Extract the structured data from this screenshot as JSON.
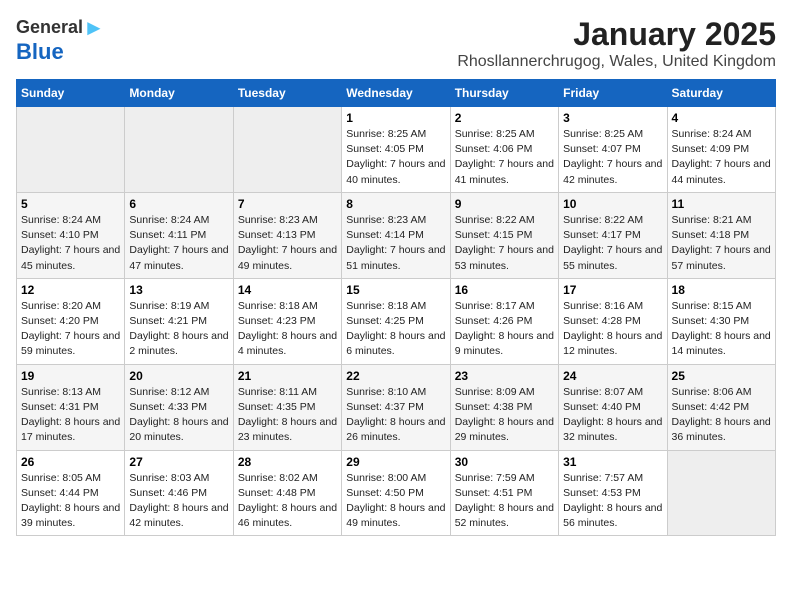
{
  "logo": {
    "general": "General",
    "blue": "Blue"
  },
  "title": "January 2025",
  "location": "Rhosllannerchrugog, Wales, United Kingdom",
  "days_of_week": [
    "Sunday",
    "Monday",
    "Tuesday",
    "Wednesday",
    "Thursday",
    "Friday",
    "Saturday"
  ],
  "weeks": [
    [
      {
        "day": null
      },
      {
        "day": null
      },
      {
        "day": null
      },
      {
        "day": "1",
        "sunrise": "Sunrise: 8:25 AM",
        "sunset": "Sunset: 4:05 PM",
        "daylight": "Daylight: 7 hours and 40 minutes."
      },
      {
        "day": "2",
        "sunrise": "Sunrise: 8:25 AM",
        "sunset": "Sunset: 4:06 PM",
        "daylight": "Daylight: 7 hours and 41 minutes."
      },
      {
        "day": "3",
        "sunrise": "Sunrise: 8:25 AM",
        "sunset": "Sunset: 4:07 PM",
        "daylight": "Daylight: 7 hours and 42 minutes."
      },
      {
        "day": "4",
        "sunrise": "Sunrise: 8:24 AM",
        "sunset": "Sunset: 4:09 PM",
        "daylight": "Daylight: 7 hours and 44 minutes."
      }
    ],
    [
      {
        "day": "5",
        "sunrise": "Sunrise: 8:24 AM",
        "sunset": "Sunset: 4:10 PM",
        "daylight": "Daylight: 7 hours and 45 minutes."
      },
      {
        "day": "6",
        "sunrise": "Sunrise: 8:24 AM",
        "sunset": "Sunset: 4:11 PM",
        "daylight": "Daylight: 7 hours and 47 minutes."
      },
      {
        "day": "7",
        "sunrise": "Sunrise: 8:23 AM",
        "sunset": "Sunset: 4:13 PM",
        "daylight": "Daylight: 7 hours and 49 minutes."
      },
      {
        "day": "8",
        "sunrise": "Sunrise: 8:23 AM",
        "sunset": "Sunset: 4:14 PM",
        "daylight": "Daylight: 7 hours and 51 minutes."
      },
      {
        "day": "9",
        "sunrise": "Sunrise: 8:22 AM",
        "sunset": "Sunset: 4:15 PM",
        "daylight": "Daylight: 7 hours and 53 minutes."
      },
      {
        "day": "10",
        "sunrise": "Sunrise: 8:22 AM",
        "sunset": "Sunset: 4:17 PM",
        "daylight": "Daylight: 7 hours and 55 minutes."
      },
      {
        "day": "11",
        "sunrise": "Sunrise: 8:21 AM",
        "sunset": "Sunset: 4:18 PM",
        "daylight": "Daylight: 7 hours and 57 minutes."
      }
    ],
    [
      {
        "day": "12",
        "sunrise": "Sunrise: 8:20 AM",
        "sunset": "Sunset: 4:20 PM",
        "daylight": "Daylight: 7 hours and 59 minutes."
      },
      {
        "day": "13",
        "sunrise": "Sunrise: 8:19 AM",
        "sunset": "Sunset: 4:21 PM",
        "daylight": "Daylight: 8 hours and 2 minutes."
      },
      {
        "day": "14",
        "sunrise": "Sunrise: 8:18 AM",
        "sunset": "Sunset: 4:23 PM",
        "daylight": "Daylight: 8 hours and 4 minutes."
      },
      {
        "day": "15",
        "sunrise": "Sunrise: 8:18 AM",
        "sunset": "Sunset: 4:25 PM",
        "daylight": "Daylight: 8 hours and 6 minutes."
      },
      {
        "day": "16",
        "sunrise": "Sunrise: 8:17 AM",
        "sunset": "Sunset: 4:26 PM",
        "daylight": "Daylight: 8 hours and 9 minutes."
      },
      {
        "day": "17",
        "sunrise": "Sunrise: 8:16 AM",
        "sunset": "Sunset: 4:28 PM",
        "daylight": "Daylight: 8 hours and 12 minutes."
      },
      {
        "day": "18",
        "sunrise": "Sunrise: 8:15 AM",
        "sunset": "Sunset: 4:30 PM",
        "daylight": "Daylight: 8 hours and 14 minutes."
      }
    ],
    [
      {
        "day": "19",
        "sunrise": "Sunrise: 8:13 AM",
        "sunset": "Sunset: 4:31 PM",
        "daylight": "Daylight: 8 hours and 17 minutes."
      },
      {
        "day": "20",
        "sunrise": "Sunrise: 8:12 AM",
        "sunset": "Sunset: 4:33 PM",
        "daylight": "Daylight: 8 hours and 20 minutes."
      },
      {
        "day": "21",
        "sunrise": "Sunrise: 8:11 AM",
        "sunset": "Sunset: 4:35 PM",
        "daylight": "Daylight: 8 hours and 23 minutes."
      },
      {
        "day": "22",
        "sunrise": "Sunrise: 8:10 AM",
        "sunset": "Sunset: 4:37 PM",
        "daylight": "Daylight: 8 hours and 26 minutes."
      },
      {
        "day": "23",
        "sunrise": "Sunrise: 8:09 AM",
        "sunset": "Sunset: 4:38 PM",
        "daylight": "Daylight: 8 hours and 29 minutes."
      },
      {
        "day": "24",
        "sunrise": "Sunrise: 8:07 AM",
        "sunset": "Sunset: 4:40 PM",
        "daylight": "Daylight: 8 hours and 32 minutes."
      },
      {
        "day": "25",
        "sunrise": "Sunrise: 8:06 AM",
        "sunset": "Sunset: 4:42 PM",
        "daylight": "Daylight: 8 hours and 36 minutes."
      }
    ],
    [
      {
        "day": "26",
        "sunrise": "Sunrise: 8:05 AM",
        "sunset": "Sunset: 4:44 PM",
        "daylight": "Daylight: 8 hours and 39 minutes."
      },
      {
        "day": "27",
        "sunrise": "Sunrise: 8:03 AM",
        "sunset": "Sunset: 4:46 PM",
        "daylight": "Daylight: 8 hours and 42 minutes."
      },
      {
        "day": "28",
        "sunrise": "Sunrise: 8:02 AM",
        "sunset": "Sunset: 4:48 PM",
        "daylight": "Daylight: 8 hours and 46 minutes."
      },
      {
        "day": "29",
        "sunrise": "Sunrise: 8:00 AM",
        "sunset": "Sunset: 4:50 PM",
        "daylight": "Daylight: 8 hours and 49 minutes."
      },
      {
        "day": "30",
        "sunrise": "Sunrise: 7:59 AM",
        "sunset": "Sunset: 4:51 PM",
        "daylight": "Daylight: 8 hours and 52 minutes."
      },
      {
        "day": "31",
        "sunrise": "Sunrise: 7:57 AM",
        "sunset": "Sunset: 4:53 PM",
        "daylight": "Daylight: 8 hours and 56 minutes."
      },
      {
        "day": null
      }
    ]
  ]
}
